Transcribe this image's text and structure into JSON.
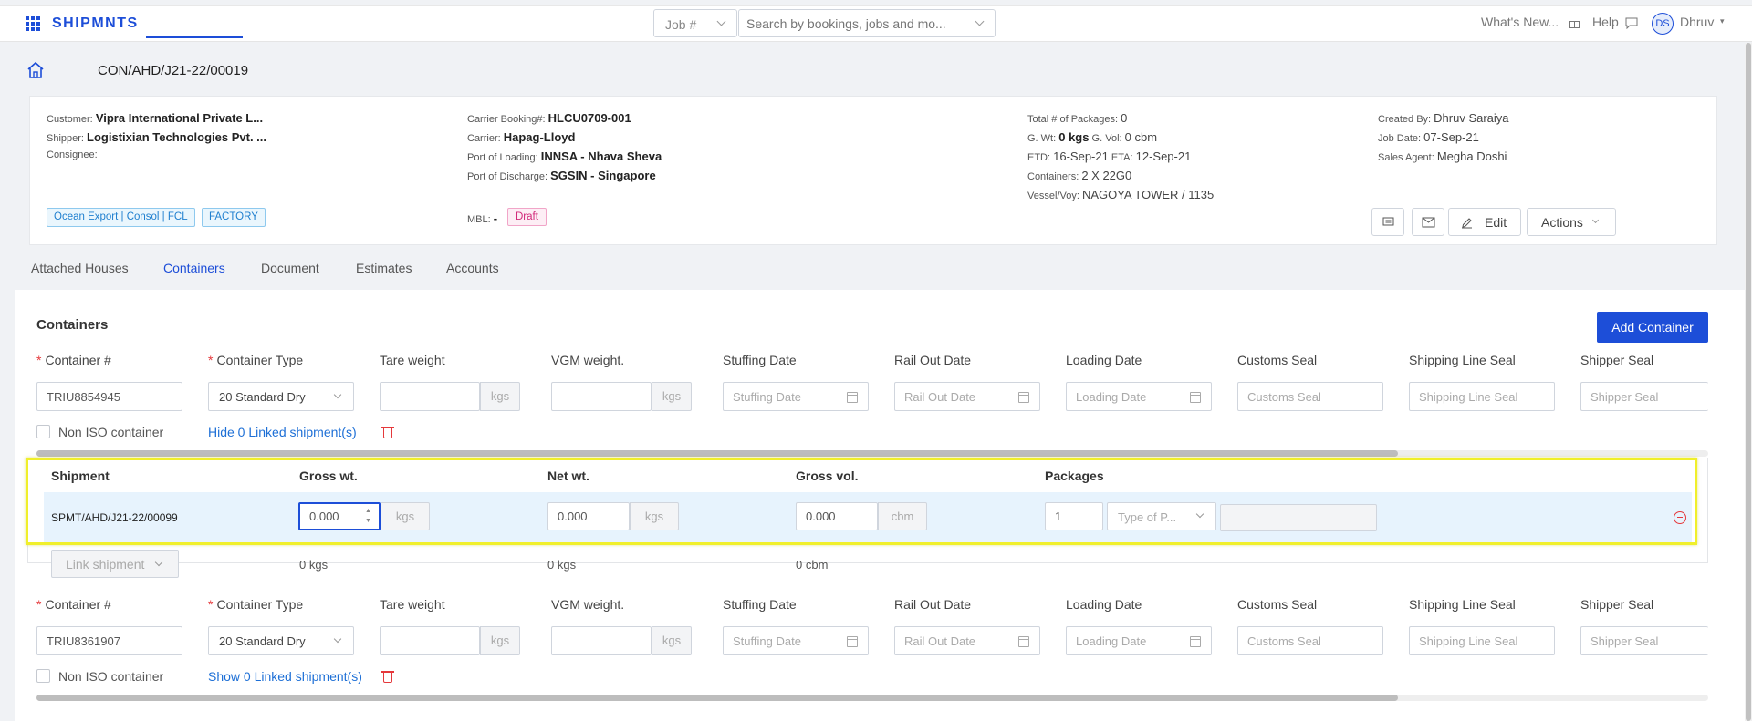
{
  "app": {
    "brand": "SHIPMNTS"
  },
  "topbar": {
    "job_select": "Job #",
    "search_placeholder": "Search by bookings, jobs and mo...",
    "whats_new": "What's New...",
    "help": "Help",
    "user_initials": "DS",
    "user_name": "Dhruv"
  },
  "booking": {
    "number": "CON/AHD/J21-22/00019",
    "col1": {
      "customer_label": "Customer:",
      "customer": "Vipra International Private L...",
      "shipper_label": "Shipper:",
      "shipper": "Logistixian Technologies Pvt. ...",
      "consignee_label": "Consignee:"
    },
    "col2": {
      "carrier_booking_label": "Carrier Booking#:",
      "carrier_booking": "HLCU0709-001",
      "carrier_label": "Carrier:",
      "carrier": "Hapag-Lloyd",
      "pol_label": "Port of Loading:",
      "pol": "INNSA - Nhava Sheva",
      "pod_label": "Port of Discharge:",
      "pod": "SGSIN - Singapore",
      "mbl_label": "MBL:",
      "mbl": "-",
      "status": "Draft"
    },
    "col3": {
      "packages_label": "Total # of Packages:",
      "packages": "0",
      "gwt_label": "G. Wt:",
      "gwt": "0 kgs",
      "gvol_label": "G. Vol:",
      "gvol": "0 cbm",
      "etd_label": "ETD:",
      "etd": "16-Sep-21",
      "eta_label": "ETA:",
      "eta": "12-Sep-21",
      "containers_label": "Containers:",
      "containers": "2 X 22G0",
      "vessel_label": "Vessel/Voy:",
      "vessel": "NAGOYA TOWER / 1135"
    },
    "col4": {
      "created_by_label": "Created By:",
      "created_by": "Dhruv Saraiya",
      "job_date_label": "Job Date:",
      "job_date": "07-Sep-21",
      "sales_agent_label": "Sales Agent:",
      "sales_agent": "Megha Doshi"
    },
    "tags": [
      "Ocean Export | Consol | FCL",
      "FACTORY"
    ],
    "actions": {
      "edit": "Edit",
      "actions": "Actions"
    }
  },
  "tabs": [
    "Attached Houses",
    "Containers",
    "Document",
    "Estimates",
    "Accounts"
  ],
  "containers_section": {
    "title": "Containers",
    "add_button": "Add Container",
    "labels": {
      "container_no": "Container #",
      "container_type": "Container Type",
      "tare": "Tare weight",
      "vgm": "VGM weight.",
      "stuffing": "Stuffing Date",
      "rail_out": "Rail Out Date",
      "loading": "Loading Date",
      "customs_seal": "Customs Seal",
      "shipping_line_seal": "Shipping Line Seal",
      "shipper_seal": "Shipper Seal",
      "non_iso": "Non ISO container"
    },
    "placeholders": {
      "stuffing": "Stuffing Date",
      "rail_out": "Rail Out Date",
      "loading": "Loading Date",
      "customs_seal": "Customs Seal",
      "shipping_line_seal": "Shipping Line Seal",
      "shipper_seal": "Shipper Seal"
    },
    "unit_kgs": "kgs",
    "containers": [
      {
        "number": "TRIU8854945",
        "type": "20 Standard Dry",
        "linked_toggle": "Hide 0 Linked shipment(s)"
      },
      {
        "number": "TRIU8361907",
        "type": "20 Standard Dry",
        "linked_toggle": "Show 0 Linked shipment(s)"
      }
    ],
    "shipments_table": {
      "headers": [
        "Shipment",
        "Gross wt.",
        "Net wt.",
        "Gross vol.",
        "Packages"
      ],
      "row": {
        "shipment": "SPMT/AHD/J21-22/00099",
        "gross_wt": "0.000",
        "gross_unit": "kgs",
        "net_wt": "0.000",
        "net_unit": "kgs",
        "gross_vol": "0.000",
        "vol_unit": "cbm",
        "packages": "1",
        "package_type_placeholder": "Type of P..."
      },
      "link_shipment": "Link shipment",
      "totals": {
        "gross": "0 kgs",
        "net": "0 kgs",
        "vol": "0 cbm"
      }
    }
  }
}
